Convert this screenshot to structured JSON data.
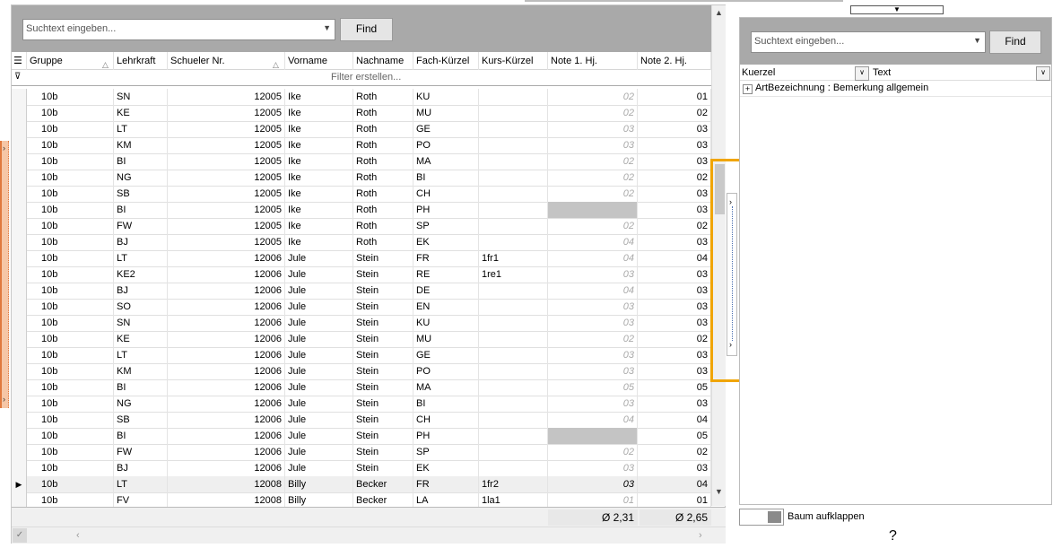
{
  "grid": {
    "search_placeholder": "Suchtext eingeben...",
    "find_label": "Find",
    "columns": [
      "Gruppe",
      "Lehrkraft",
      "Schueler Nr.",
      "Vorname",
      "Nachname",
      "Fach-Kürzel",
      "Kurs-Kürzel",
      "Note 1. Hj.",
      "Note 2. Hj."
    ],
    "filter_placeholder": "Filter erstellen...",
    "rows": [
      {
        "g": "10b",
        "l": "SN",
        "s": "12005",
        "v": "Ike",
        "n": "Roth",
        "f": "KU",
        "k": "",
        "n1": "02",
        "n2": "01"
      },
      {
        "g": "10b",
        "l": "KE",
        "s": "12005",
        "v": "Ike",
        "n": "Roth",
        "f": "MU",
        "k": "",
        "n1": "02",
        "n2": "02"
      },
      {
        "g": "10b",
        "l": "LT",
        "s": "12005",
        "v": "Ike",
        "n": "Roth",
        "f": "GE",
        "k": "",
        "n1": "03",
        "n2": "03"
      },
      {
        "g": "10b",
        "l": "KM",
        "s": "12005",
        "v": "Ike",
        "n": "Roth",
        "f": "PO",
        "k": "",
        "n1": "03",
        "n2": "03"
      },
      {
        "g": "10b",
        "l": "BI",
        "s": "12005",
        "v": "Ike",
        "n": "Roth",
        "f": "MA",
        "k": "",
        "n1": "02",
        "n2": "03"
      },
      {
        "g": "10b",
        "l": "NG",
        "s": "12005",
        "v": "Ike",
        "n": "Roth",
        "f": "BI",
        "k": "",
        "n1": "02",
        "n2": "02"
      },
      {
        "g": "10b",
        "l": "SB",
        "s": "12005",
        "v": "Ike",
        "n": "Roth",
        "f": "CH",
        "k": "",
        "n1": "02",
        "n2": "03"
      },
      {
        "g": "10b",
        "l": "BI",
        "s": "12005",
        "v": "Ike",
        "n": "Roth",
        "f": "PH",
        "k": "",
        "n1": "",
        "n2": "03"
      },
      {
        "g": "10b",
        "l": "FW",
        "s": "12005",
        "v": "Ike",
        "n": "Roth",
        "f": "SP",
        "k": "",
        "n1": "02",
        "n2": "02"
      },
      {
        "g": "10b",
        "l": "BJ",
        "s": "12005",
        "v": "Ike",
        "n": "Roth",
        "f": "EK",
        "k": "",
        "n1": "04",
        "n2": "03"
      },
      {
        "g": "10b",
        "l": "LT",
        "s": "12006",
        "v": "Jule",
        "n": "Stein",
        "f": "FR",
        "k": "1fr1",
        "n1": "04",
        "n2": "04"
      },
      {
        "g": "10b",
        "l": "KE2",
        "s": "12006",
        "v": "Jule",
        "n": "Stein",
        "f": "RE",
        "k": "1re1",
        "n1": "03",
        "n2": "03"
      },
      {
        "g": "10b",
        "l": "BJ",
        "s": "12006",
        "v": "Jule",
        "n": "Stein",
        "f": "DE",
        "k": "",
        "n1": "04",
        "n2": "03"
      },
      {
        "g": "10b",
        "l": "SO",
        "s": "12006",
        "v": "Jule",
        "n": "Stein",
        "f": "EN",
        "k": "",
        "n1": "03",
        "n2": "03"
      },
      {
        "g": "10b",
        "l": "SN",
        "s": "12006",
        "v": "Jule",
        "n": "Stein",
        "f": "KU",
        "k": "",
        "n1": "03",
        "n2": "03"
      },
      {
        "g": "10b",
        "l": "KE",
        "s": "12006",
        "v": "Jule",
        "n": "Stein",
        "f": "MU",
        "k": "",
        "n1": "02",
        "n2": "02"
      },
      {
        "g": "10b",
        "l": "LT",
        "s": "12006",
        "v": "Jule",
        "n": "Stein",
        "f": "GE",
        "k": "",
        "n1": "03",
        "n2": "03"
      },
      {
        "g": "10b",
        "l": "KM",
        "s": "12006",
        "v": "Jule",
        "n": "Stein",
        "f": "PO",
        "k": "",
        "n1": "03",
        "n2": "03"
      },
      {
        "g": "10b",
        "l": "BI",
        "s": "12006",
        "v": "Jule",
        "n": "Stein",
        "f": "MA",
        "k": "",
        "n1": "05",
        "n2": "05"
      },
      {
        "g": "10b",
        "l": "NG",
        "s": "12006",
        "v": "Jule",
        "n": "Stein",
        "f": "BI",
        "k": "",
        "n1": "03",
        "n2": "03"
      },
      {
        "g": "10b",
        "l": "SB",
        "s": "12006",
        "v": "Jule",
        "n": "Stein",
        "f": "CH",
        "k": "",
        "n1": "04",
        "n2": "04"
      },
      {
        "g": "10b",
        "l": "BI",
        "s": "12006",
        "v": "Jule",
        "n": "Stein",
        "f": "PH",
        "k": "",
        "n1": "",
        "n2": "05"
      },
      {
        "g": "10b",
        "l": "FW",
        "s": "12006",
        "v": "Jule",
        "n": "Stein",
        "f": "SP",
        "k": "",
        "n1": "02",
        "n2": "02"
      },
      {
        "g": "10b",
        "l": "BJ",
        "s": "12006",
        "v": "Jule",
        "n": "Stein",
        "f": "EK",
        "k": "",
        "n1": "03",
        "n2": "03"
      },
      {
        "g": "10b",
        "l": "LT",
        "s": "12008",
        "v": "Billy",
        "n": "Becker",
        "f": "FR",
        "k": "1fr2",
        "n1": "03",
        "n2": "04"
      },
      {
        "g": "10b",
        "l": "FV",
        "s": "12008",
        "v": "Billy",
        "n": "Becker",
        "f": "LA",
        "k": "1la1",
        "n1": "01",
        "n2": "01"
      }
    ],
    "current_row_index": 24,
    "sum_note1": "Ø 2,31",
    "sum_note2": "Ø 2,65"
  },
  "right_panel": {
    "search_placeholder": "Suchtext eingeben...",
    "find_label": "Find",
    "col_kuerzel": "Kuerzel",
    "col_text": "Text",
    "tree_item": "ArtBezeichnung : Bemerkung allgemein"
  },
  "toggle_label": "Baum aufklappen",
  "colors": {
    "highlight": "#f0a500",
    "splitter": "#e0793e",
    "band": "#a9a9a9"
  },
  "icons": [
    "chevron-down-icon",
    "sort-asc-icon",
    "column-chooser-icon",
    "filter-icon",
    "row-indicator-icon",
    "scroll-up-icon",
    "scroll-down-icon",
    "scroll-left-icon",
    "scroll-right-icon",
    "expand-icon",
    "help-icon"
  ]
}
